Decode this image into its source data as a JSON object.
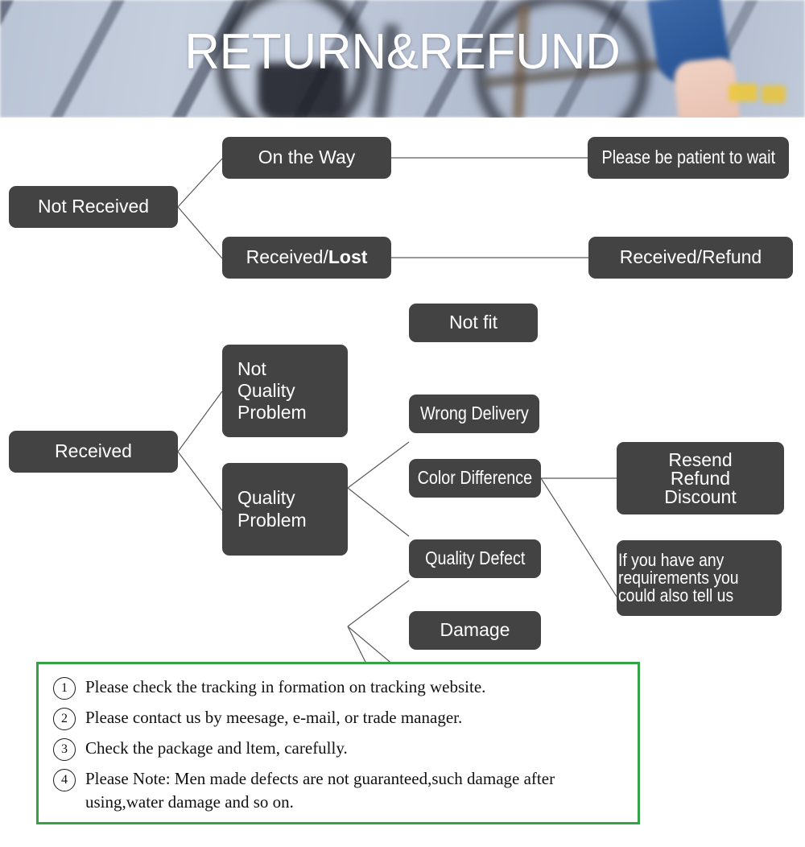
{
  "banner": {
    "title": "RETURN&REFUND",
    "image_description": "blurred photo of wooden deck planks with a bicycle and a person's legs in blue denim shorts"
  },
  "flowchart": {
    "nodes": [
      {
        "id": "not-received",
        "label": "Not Received"
      },
      {
        "id": "on-the-way",
        "label": "On the Way"
      },
      {
        "id": "received-lost",
        "label": "Received/",
        "label_bold": "Lost"
      },
      {
        "id": "please-be-patient",
        "label": "Please be patient to wait"
      },
      {
        "id": "received-refund",
        "label": "Received/Refund"
      },
      {
        "id": "received",
        "label": "Received"
      },
      {
        "id": "not-quality-problem",
        "label": "Not\nQuality\nProblem"
      },
      {
        "id": "quality-problem",
        "label": "Quality\nProblem"
      },
      {
        "id": "not-fit",
        "label": "Not fit"
      },
      {
        "id": "wrong-delivery",
        "label": "Wrong Delivery"
      },
      {
        "id": "color-difference",
        "label": "Color Difference"
      },
      {
        "id": "quality-defect",
        "label": "Quality Defect"
      },
      {
        "id": "damage",
        "label": "Damage"
      },
      {
        "id": "resend-refund-discount",
        "label": "Resend\nRefund\nDiscount"
      },
      {
        "id": "if-you-have-any-requirements",
        "label": "If you have any\nrequirements you\ncould also tell us"
      }
    ],
    "node_labels": {
      "not_received": "Not Received",
      "on_the_way": "On the Way",
      "received_lost_prefix": "Received/",
      "received_lost_bold": "Lost",
      "please_be_patient": "Please be patient to wait",
      "received_refund": "Received/Refund",
      "received": "Received",
      "not_quality_problem_l1": "Not",
      "not_quality_problem_l2": "Quality",
      "not_quality_problem_l3": "Problem",
      "quality_problem_l1": "Quality",
      "quality_problem_l2": "Problem",
      "not_fit": "Not fit",
      "wrong_delivery": "Wrong Delivery",
      "color_difference": "Color Difference",
      "quality_defect": "Quality Defect",
      "damage": "Damage",
      "resend": "Resend",
      "refund": "Refund",
      "discount": "Discount",
      "req_l1": "If you have any",
      "req_l2": "requirements you",
      "req_l3": "could also tell us"
    }
  },
  "notes": {
    "items": [
      {
        "number": "1",
        "text": "Please check the tracking in formation on tracking website."
      },
      {
        "number": "2",
        "text": "Please contact us by meesage, e-mail, or trade manager."
      },
      {
        "number": "3",
        "text": "Check the package and ltem, carefully."
      },
      {
        "number": "4",
        "text": "Please Note: Men made defects  are not guaranteed,such damage after using,water damage and so on."
      }
    ]
  },
  "colors": {
    "node_fill": "#434343",
    "node_text": "#ffffff",
    "line": "#595959",
    "notes_border": "#33a348",
    "page_background": "#ffffff",
    "banner_title": "#ffffff"
  }
}
